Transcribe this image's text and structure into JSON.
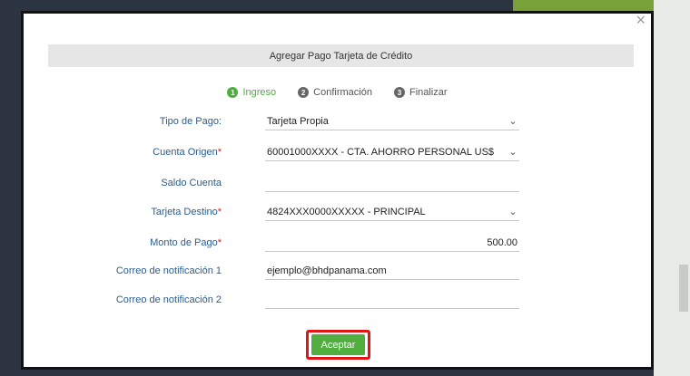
{
  "dialog": {
    "title": "Agregar Pago Tarjeta de Crédito",
    "close_glyph": "×"
  },
  "steps": [
    {
      "num": "1",
      "label": "Ingreso",
      "active": true
    },
    {
      "num": "2",
      "label": "Confirmación",
      "active": false
    },
    {
      "num": "3",
      "label": "Finalizar",
      "active": false
    }
  ],
  "form": {
    "tipo_pago": {
      "label": "Tipo de Pago:",
      "value": "Tarjeta Propia"
    },
    "cuenta_origen": {
      "label": "Cuenta Origen",
      "required": "*",
      "value": "60001000XXXX  - CTA. AHORRO PERSONAL US$"
    },
    "saldo_cuenta": {
      "label": "Saldo Cuenta",
      "value": ""
    },
    "tarjeta_destino": {
      "label": "Tarjeta Destino",
      "required": "*",
      "value": "4824XXX0000XXXXX - PRINCIPAL"
    },
    "monto_pago": {
      "label": "Monto de Pago",
      "required": "*",
      "value": "500.00"
    },
    "correo_1": {
      "label": "Correo de notificación 1",
      "value": "ejemplo@bhdpanama.com"
    },
    "correo_2": {
      "label": "Correo de notificación 2",
      "value": ""
    }
  },
  "actions": {
    "accept_label": "Aceptar"
  },
  "icons": {
    "dropdown": "chevron-down-icon"
  },
  "colors": {
    "accent_green": "#4fae3e",
    "label_blue": "#2a5d8f",
    "highlight_red": "#e21414"
  }
}
